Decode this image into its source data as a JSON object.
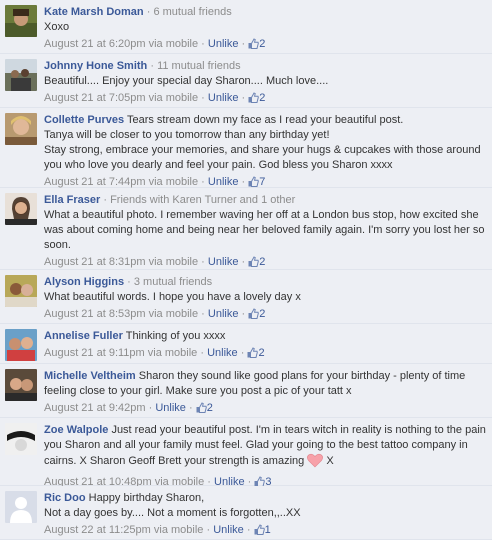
{
  "comments": [
    {
      "name": "Kate Marsh Doman",
      "friends": "6 mutual friends",
      "text": "Xoxo",
      "time": "August 21 at 6:20pm",
      "via": "via mobile",
      "unlike": "Unlike",
      "likes": "2",
      "avatar": "avatar-kate"
    },
    {
      "name": "Johnny Hone Smith",
      "friends": "11 mutual friends",
      "text": "Beautiful.... Enjoy your special day Sharon.... Much love....",
      "time": "August 21 at 7:05pm",
      "via": "via mobile",
      "unlike": "Unlike",
      "likes": "2",
      "avatar": "avatar-johnny"
    },
    {
      "name": "Collette Purves",
      "text": "Tears stream down my face as I read your beautiful post.",
      "text2": "Tanya will be closer to you tomorrow than any birthday yet!",
      "text3": "Stay strong, embrace your memories, and share your hugs & cupcakes with those around you who love you dearly and feel your pain. God bless you Sharon xxxx",
      "time": "August 21 at 7:44pm",
      "via": "via mobile",
      "unlike": "Unlike",
      "likes": "7",
      "avatar": "avatar-collette"
    },
    {
      "name": "Ella Fraser",
      "friends": "Friends with Karen Turner and 1 other",
      "text": "What a beautiful photo. I remember waving her off at a London bus stop, how excited she was about coming home and being near her beloved family again. I'm sorry you lost her so soon.",
      "time": "August 21 at 8:31pm",
      "via": "via mobile",
      "unlike": "Unlike",
      "likes": "2",
      "avatar": "avatar-ella"
    },
    {
      "name": "Alyson Higgins",
      "friends": "3 mutual friends",
      "text": "What beautiful words. I hope you have a lovely day x",
      "time": "August 21 at 8:53pm",
      "via": "via mobile",
      "unlike": "Unlike",
      "likes": "2",
      "avatar": "avatar-alyson"
    },
    {
      "name": "Annelise Fuller",
      "text": "Thinking of you xxxx",
      "time": "August 21 at 9:11pm",
      "via": "via mobile",
      "unlike": "Unlike",
      "likes": "2",
      "avatar": "avatar-annelise"
    },
    {
      "name": "Michelle Veltheim",
      "text": "Sharon they sound like good plans for your birthday - plenty of time feeling close to your girl. Make sure you post a pic of your tatt x",
      "time": "August 21 at 9:42pm",
      "unlike": "Unlike",
      "likes": "2",
      "avatar": "avatar-michelle"
    },
    {
      "name": "Zoe Walpole",
      "text": "Just read your beautiful post. I'm in tears witch in reality is nothing to the pain you Sharon and all your family must feel. Glad your going to the best tattoo company in cairns. X Sharon Geoff Brett your strength is amazing",
      "text_tail": "X",
      "time": "August 21 at 10:48pm",
      "via": "via mobile",
      "unlike": "Unlike",
      "likes": "3",
      "avatar": "avatar-zoe"
    },
    {
      "name": "Ric Doo",
      "text": "Happy birthday Sharon,",
      "text2": "Not a day goes by.... Not a moment is forgotten,,..XX",
      "time": "August 22 at 11:25pm",
      "via": "via mobile",
      "unlike": "Unlike",
      "likes": "1",
      "avatar": "avatar-ric"
    }
  ],
  "colors": {
    "name_link": "#3b5998",
    "meta_gray": "#8c8c8c",
    "comment_bg": "#edeff4",
    "heart": "#f7a1a9"
  }
}
